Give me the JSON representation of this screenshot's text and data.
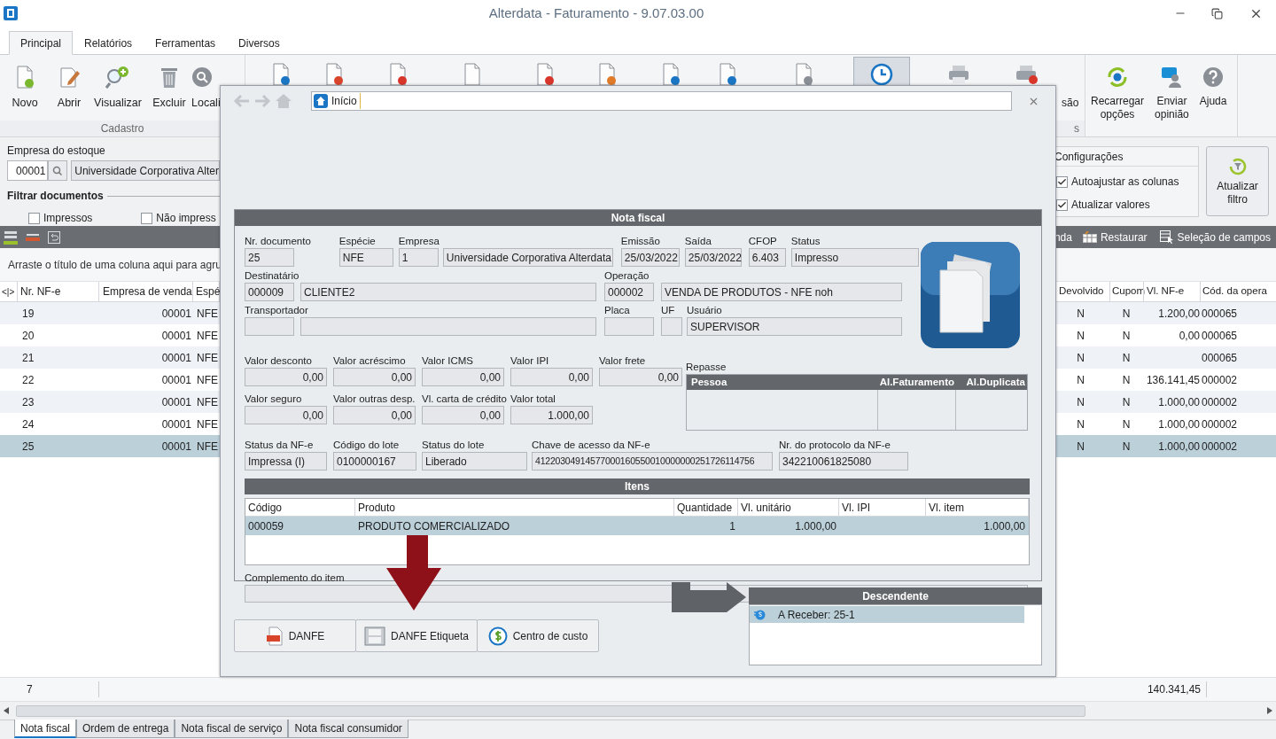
{
  "window": {
    "title": "Alterdata - Faturamento - 9.07.03.00"
  },
  "ribbon_tabs": [
    {
      "label": "Principal",
      "selected": true
    },
    {
      "label": "Relatórios",
      "selected": false
    },
    {
      "label": "Ferramentas",
      "selected": false
    },
    {
      "label": "Diversos",
      "selected": false
    }
  ],
  "ribbon_cadastro": {
    "group": "Cadastro",
    "buttons": [
      {
        "kind": "new",
        "label": "Novo"
      },
      {
        "kind": "edit",
        "label": "Abrir"
      },
      {
        "kind": "view",
        "label": "Visualizar"
      },
      {
        "kind": "delete",
        "label": "Excluir"
      },
      {
        "kind": "find",
        "label": "Locali"
      }
    ]
  },
  "ribbon_print": {
    "group": "s",
    "buttons": [
      {
        "kind": "clock",
        "pressed": true
      },
      {
        "kind": "printer",
        "pressed": false
      },
      {
        "kind": "printer-cancel",
        "pressed": false,
        "label": [
          "são"
        ]
      }
    ]
  },
  "ribbon_help": [
    {
      "kind": "reload",
      "label": [
        "Recarregar",
        "opções"
      ]
    },
    {
      "kind": "feedback",
      "label": [
        "Enviar",
        "opinião"
      ]
    },
    {
      "kind": "help",
      "label": [
        "Ajuda"
      ]
    }
  ],
  "filter": {
    "empresa_label": "Empresa do estoque",
    "empresa_code": "00001",
    "empresa_name": "Universidade Corporativa Alter",
    "section": "Filtrar documentos",
    "checkboxes": [
      {
        "label": "Impressos",
        "checked": false
      },
      {
        "label": "Não impress",
        "checked": false
      }
    ]
  },
  "config": {
    "title": "Configurações",
    "options": [
      {
        "label": "Autoajustar as colunas",
        "checked": true
      },
      {
        "label": "Atualizar valores",
        "checked": true
      }
    ],
    "refresh_button": [
      "Atualizar",
      "filtro"
    ]
  },
  "grid_toolbar": {
    "items": [
      "nda",
      "Restaurar",
      "Seleção de campos"
    ]
  },
  "grid": {
    "group_hint": "Arraste o título de uma coluna aqui para agru",
    "columns_left": [
      "<|>",
      "Nr. NF-e",
      "Empresa de venda",
      "Espé"
    ],
    "columns_right": [
      "Devolvido",
      "Cupom",
      "Vl. NF-e",
      "Cód. da opera"
    ],
    "rows": [
      {
        "nr": "19",
        "empresa": "00001",
        "especie": "NFE",
        "devolvido": "N",
        "cupom": "N",
        "valor": "1.200,00",
        "operacao": "000065",
        "selected": false
      },
      {
        "nr": "20",
        "empresa": "00001",
        "especie": "NFE",
        "devolvido": "N",
        "cupom": "N",
        "valor": "0,00",
        "operacao": "000065",
        "selected": false
      },
      {
        "nr": "21",
        "empresa": "00001",
        "especie": "NFE",
        "devolvido": "N",
        "cupom": "N",
        "operacao": "000065",
        "selected": false
      },
      {
        "nr": "22",
        "empresa": "00001",
        "especie": "NFE",
        "devolvido": "N",
        "cupom": "N",
        "valor": "136.141,45",
        "operacao": "000002",
        "selected": false
      },
      {
        "nr": "23",
        "empresa": "00001",
        "especie": "NFE",
        "devolvido": "N",
        "cupom": "N",
        "valor": "1.000,00",
        "operacao": "000002",
        "selected": false
      },
      {
        "nr": "24",
        "empresa": "00001",
        "especie": "NFE",
        "devolvido": "N",
        "cupom": "N",
        "valor": "1.000,00",
        "operacao": "000002",
        "selected": false
      },
      {
        "nr": "25",
        "empresa": "00001",
        "especie": "NFE",
        "devolvido": "N",
        "cupom": "N",
        "valor": "1.000,00",
        "operacao": "000002",
        "selected": true
      }
    ],
    "footer": {
      "count": "7",
      "total": "140.341,45"
    }
  },
  "sheet_tabs": [
    {
      "label": "Nota fiscal",
      "selected": true
    },
    {
      "label": "Ordem de entrega",
      "selected": false
    },
    {
      "label": "Nota fiscal de serviço",
      "selected": false
    },
    {
      "label": "Nota fiscal consumidor",
      "selected": false
    }
  ],
  "dialog": {
    "address": "Início",
    "nota_fiscal": {
      "title": "Nota fiscal",
      "row1": [
        {
          "label": "Nr. documento",
          "values": [
            "25"
          ]
        },
        {
          "label": "Espécie",
          "values": [
            "NFE"
          ]
        },
        {
          "label": "Empresa",
          "values": [
            "1",
            "Universidade Corporativa Alterdata"
          ]
        },
        {
          "label": "Emissão",
          "values": [
            "25/03/2022"
          ]
        },
        {
          "label": "Saída",
          "values": [
            "25/03/2022"
          ]
        },
        {
          "label": "CFOP",
          "values": [
            "6.403"
          ]
        },
        {
          "label": "Status",
          "values": [
            "Impresso"
          ]
        }
      ],
      "row2": [
        {
          "label": "Destinatário",
          "values": [
            "000009",
            "CLIENTE2"
          ]
        },
        {
          "label": "Operação",
          "values": [
            "000002",
            "VENDA DE PRODUTOS - NFE noh"
          ]
        }
      ],
      "row3": [
        {
          "label": "Transportador"
        },
        {
          "label": "Placa"
        },
        {
          "label": "UF"
        },
        {
          "label": "Usuário",
          "values": [
            "SUPERVISOR"
          ]
        }
      ],
      "row4": [
        {
          "label": "Valor desconto",
          "values": [
            "0,00"
          ]
        },
        {
          "label": "Valor acréscimo",
          "values": [
            "0,00"
          ]
        },
        {
          "label": "Valor ICMS",
          "values": [
            "0,00"
          ]
        },
        {
          "label": "Valor IPI",
          "values": [
            "0,00"
          ]
        },
        {
          "label": "Valor frete",
          "values": [
            "0,00"
          ]
        }
      ],
      "row5": [
        {
          "label": "Valor seguro",
          "values": [
            "0,00"
          ]
        },
        {
          "label": "Valor outras desp.",
          "values": [
            "0,00"
          ]
        },
        {
          "label": "Vl. carta de crédito",
          "values": [
            "0,00"
          ]
        },
        {
          "label": "Valor total",
          "values": [
            "1.000,00"
          ]
        }
      ],
      "repasse": {
        "label": "Repasse",
        "columns": [
          "Pessoa",
          "Al.Faturamento",
          "Al.Duplicata"
        ]
      },
      "row6": [
        {
          "label": "Status da NF-e",
          "values": [
            "Impressa (I)"
          ]
        },
        {
          "label": "Código do lote",
          "values": [
            "0100000167"
          ]
        },
        {
          "label": "Status do lote",
          "values": [
            "Liberado"
          ]
        },
        {
          "label": "Chave de acesso da NF-e",
          "values": [
            "41220304914577000160550010000000251726114756"
          ]
        },
        {
          "label": "Nr. do protocolo da NF-e",
          "values": [
            "342210061825080"
          ]
        }
      ],
      "itens": {
        "title": "Itens",
        "columns": [
          "Código",
          "Produto",
          "Quantidade",
          "Vl. unitário",
          "Vl. IPI",
          "Vl. item"
        ],
        "rows": [
          {
            "codigo": "000059",
            "produto": "PRODUTO COMERCIALIZADO",
            "quantidade": "1",
            "vl_unitario": "1.000,00",
            "vl_item": "1.000,00",
            "selected": true
          }
        ]
      },
      "complemento": {
        "label": "Complemento do item"
      }
    },
    "buttons": [
      {
        "kind": "pdf",
        "label": "DANFE"
      },
      {
        "kind": "film",
        "label": "DANFE Etiqueta"
      },
      {
        "kind": "dollar",
        "label": "Centro de custo"
      }
    ],
    "descendente": {
      "title": "Descendente",
      "items": [
        {
          "label": "A Receber: 25-1",
          "selected": true
        }
      ]
    }
  }
}
